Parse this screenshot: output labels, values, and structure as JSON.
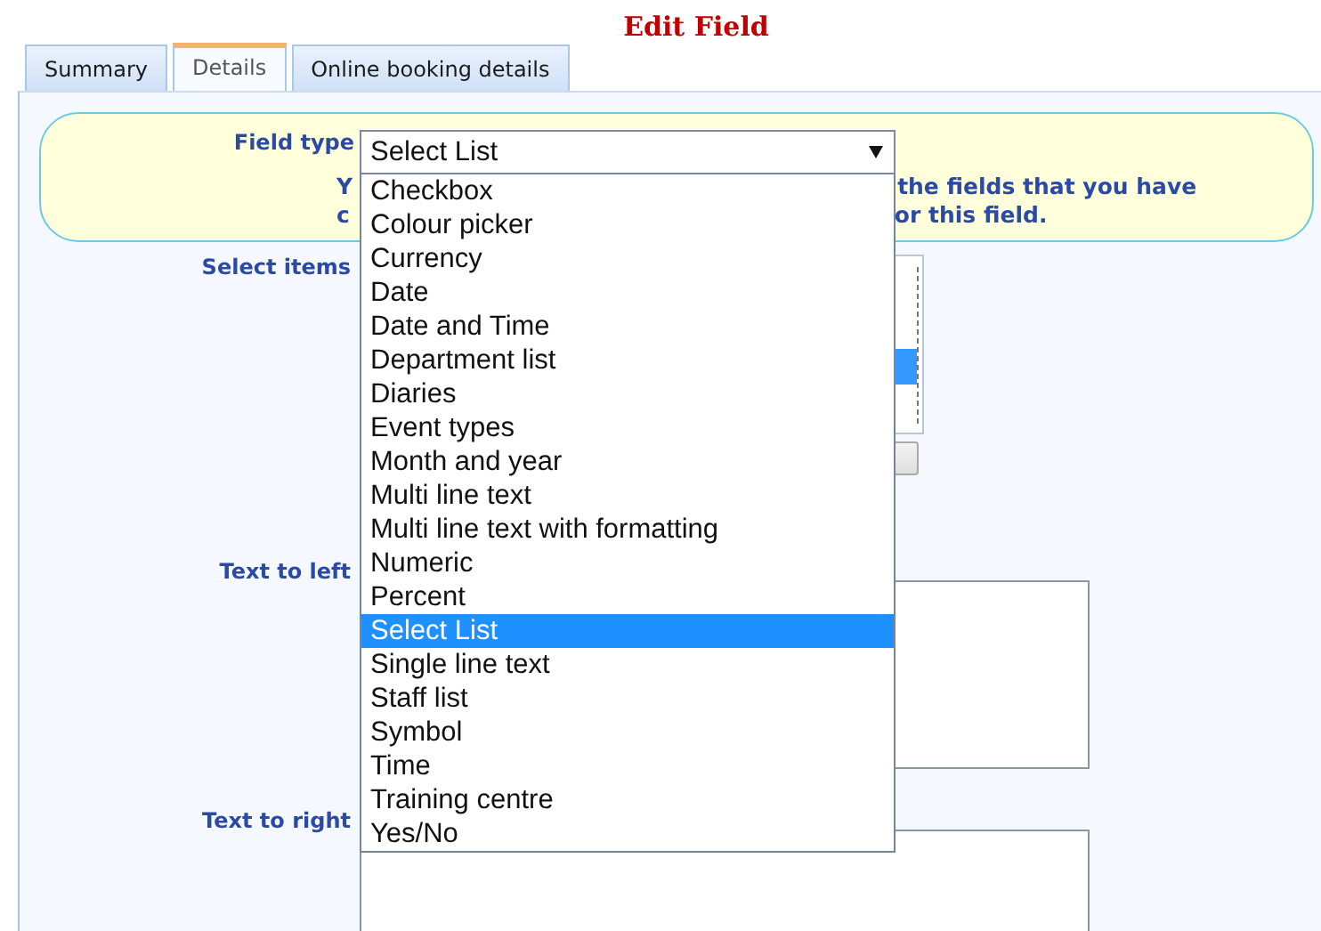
{
  "title": "Edit Field",
  "tabs": [
    {
      "label": "Summary",
      "selected": false
    },
    {
      "label": "Details",
      "selected": true
    },
    {
      "label": "Online booking details",
      "selected": false
    }
  ],
  "field_type": {
    "label": "Field type",
    "value": "Select List",
    "expanded": true,
    "options": [
      {
        "label": "Checkbox",
        "selected": false
      },
      {
        "label": "Colour picker",
        "selected": false
      },
      {
        "label": "Currency",
        "selected": false
      },
      {
        "label": "Date",
        "selected": false
      },
      {
        "label": "Date and Time",
        "selected": false
      },
      {
        "label": "Department list",
        "selected": false
      },
      {
        "label": "Diaries",
        "selected": false
      },
      {
        "label": "Event types",
        "selected": false
      },
      {
        "label": "Month and year",
        "selected": false
      },
      {
        "label": "Multi line text",
        "selected": false
      },
      {
        "label": "Multi line text with formatting",
        "selected": false
      },
      {
        "label": "Numeric",
        "selected": false
      },
      {
        "label": "Percent",
        "selected": false
      },
      {
        "label": "Select List",
        "selected": true
      },
      {
        "label": "Single line text",
        "selected": false
      },
      {
        "label": "Staff list",
        "selected": false
      },
      {
        "label": "Symbol",
        "selected": false
      },
      {
        "label": "Time",
        "selected": false
      },
      {
        "label": "Training centre",
        "selected": false
      },
      {
        "label": "Yes/No",
        "selected": false
      }
    ]
  },
  "hint_lines": [
    {
      "left": "Y",
      "right": "the fields that you have"
    },
    {
      "left": "c",
      "right": "or this field."
    }
  ],
  "select_items": {
    "label": "Select items"
  },
  "text_to_left": {
    "label": "Text to left"
  },
  "text_to_right": {
    "label": "Text to right"
  }
}
